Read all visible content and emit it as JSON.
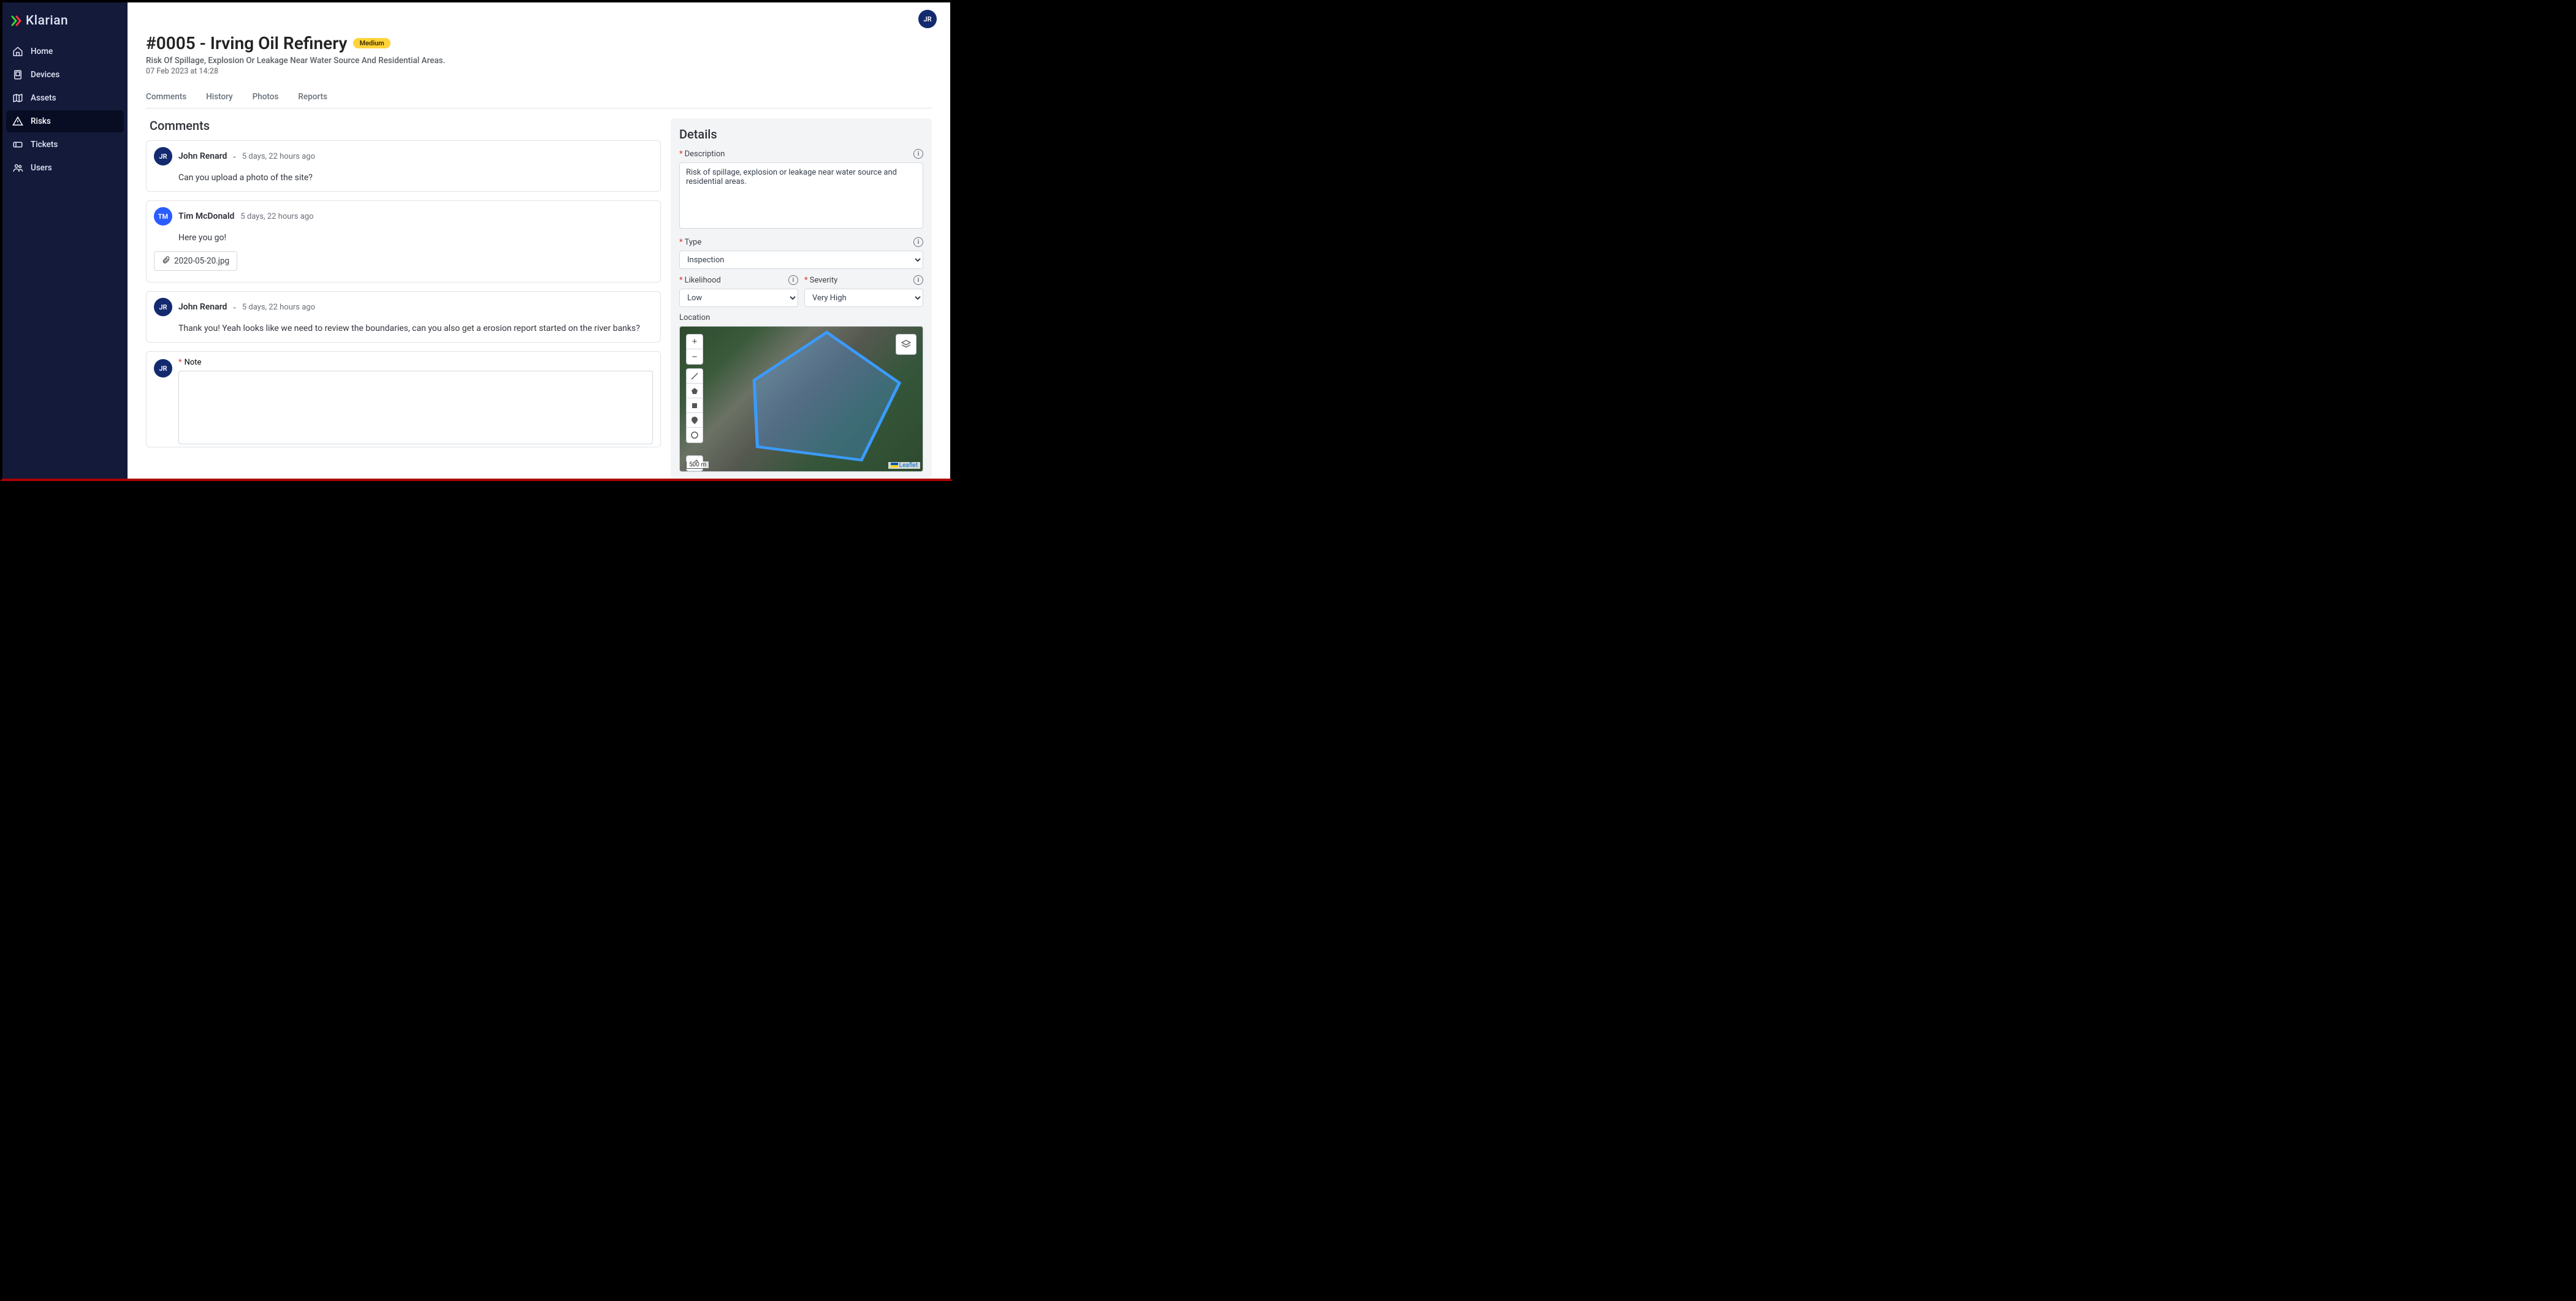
{
  "brand": {
    "name": "Klarian"
  },
  "user": {
    "initials": "JR"
  },
  "sidebar": {
    "items": [
      {
        "label": "Home",
        "icon": "home"
      },
      {
        "label": "Devices",
        "icon": "device"
      },
      {
        "label": "Assets",
        "icon": "map"
      },
      {
        "label": "Risks",
        "icon": "warning",
        "active": true
      },
      {
        "label": "Tickets",
        "icon": "ticket"
      },
      {
        "label": "Users",
        "icon": "users"
      }
    ]
  },
  "page": {
    "title": "#0005 - Irving Oil Refinery",
    "badge": "Medium",
    "subtitle": "Risk Of Spillage, Explosion Or Leakage Near Water Source And Residential Areas.",
    "timestamp": "07 Feb 2023 at 14:28"
  },
  "tabs": [
    {
      "label": "Comments"
    },
    {
      "label": "History"
    },
    {
      "label": "Photos"
    },
    {
      "label": "Reports"
    }
  ],
  "comments_section_title": "Comments",
  "comments": [
    {
      "initials": "JR",
      "avatarClass": "av-jr",
      "author": "John Renard",
      "time": "5 days, 22 hours ago",
      "sep": "-",
      "body": "Can you upload a photo of the site?"
    },
    {
      "initials": "TM",
      "avatarClass": "av-tm",
      "author": "Tim McDonald",
      "time": "5 days, 22 hours ago",
      "body": "Here you go!",
      "attachment": "2020-05-20.jpg"
    },
    {
      "initials": "JR",
      "avatarClass": "av-jr",
      "author": "John Renard",
      "time": "5 days, 22 hours ago",
      "sep": "-",
      "body": "Thank you! Yeah looks like we need to review the boundaries, can you also get a erosion report started on the river banks?"
    }
  ],
  "note": {
    "label": "Note",
    "initials": "JR"
  },
  "details": {
    "title": "Details",
    "description_label": "Description",
    "description_value": "Risk of spillage, explosion or leakage near water source and residential areas.",
    "type_label": "Type",
    "type_value": "Inspection",
    "likelihood_label": "Likelihood",
    "likelihood_value": "Low",
    "severity_label": "Severity",
    "severity_value": "Very High",
    "location_label": "Location"
  },
  "map": {
    "scale": "500 m",
    "attribution": "Leaflet"
  }
}
